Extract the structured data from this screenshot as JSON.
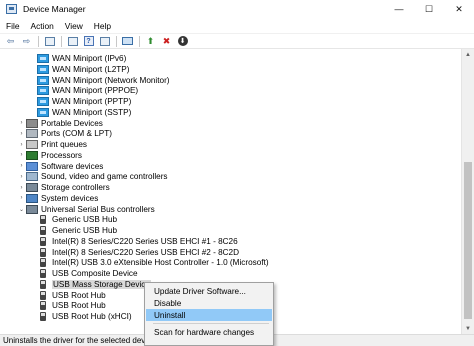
{
  "window": {
    "title": "Device Manager",
    "minimize": "—",
    "maximize": "☐",
    "close": "✕"
  },
  "menu": [
    "File",
    "Action",
    "View",
    "Help"
  ],
  "toolbar": {
    "back": "⇦",
    "forward": "⇨",
    "enable": "⬆",
    "disable": "✖",
    "uninstall": "⬇"
  },
  "tree": [
    {
      "label": "WAN Miniport (IPv6)",
      "level": 2,
      "icon": "network-adapter-icon"
    },
    {
      "label": "WAN Miniport (L2TP)",
      "level": 2,
      "icon": "network-adapter-icon"
    },
    {
      "label": "WAN Miniport (Network Monitor)",
      "level": 2,
      "icon": "network-adapter-icon"
    },
    {
      "label": "WAN Miniport (PPPOE)",
      "level": 2,
      "icon": "network-adapter-icon"
    },
    {
      "label": "WAN Miniport (PPTP)",
      "level": 2,
      "icon": "network-adapter-icon"
    },
    {
      "label": "WAN Miniport (SSTP)",
      "level": 2,
      "icon": "network-adapter-icon"
    },
    {
      "label": "Portable Devices",
      "level": 1,
      "icon": "portable-device-icon",
      "expander": "›"
    },
    {
      "label": "Ports (COM & LPT)",
      "level": 1,
      "icon": "port-icon",
      "expander": "›"
    },
    {
      "label": "Print queues",
      "level": 1,
      "icon": "printer-icon",
      "expander": "›"
    },
    {
      "label": "Processors",
      "level": 1,
      "icon": "processor-icon",
      "expander": "›"
    },
    {
      "label": "Software devices",
      "level": 1,
      "icon": "software-device-icon",
      "expander": "›"
    },
    {
      "label": "Sound, video and game controllers",
      "level": 1,
      "icon": "sound-icon",
      "expander": "›"
    },
    {
      "label": "Storage controllers",
      "level": 1,
      "icon": "storage-controller-icon",
      "expander": "›"
    },
    {
      "label": "System devices",
      "level": 1,
      "icon": "system-device-icon",
      "expander": "›"
    },
    {
      "label": "Universal Serial Bus controllers",
      "level": 1,
      "icon": "usb-controller-icon",
      "expander": "⌄"
    },
    {
      "label": "Generic USB Hub",
      "level": 2,
      "icon": "usb-icon"
    },
    {
      "label": "Generic USB Hub",
      "level": 2,
      "icon": "usb-icon"
    },
    {
      "label": "Intel(R) 8 Series/C220 Series USB EHCI #1 - 8C26",
      "level": 2,
      "icon": "usb-icon"
    },
    {
      "label": "Intel(R) 8 Series/C220 Series USB EHCI #2 - 8C2D",
      "level": 2,
      "icon": "usb-icon"
    },
    {
      "label": "Intel(R) USB 3.0 eXtensible Host Controller - 1.0 (Microsoft)",
      "level": 2,
      "icon": "usb-icon"
    },
    {
      "label": "USB Composite Device",
      "level": 2,
      "icon": "usb-icon"
    },
    {
      "label": "USB Mass Storage Device",
      "level": 2,
      "icon": "usb-icon",
      "selected": true
    },
    {
      "label": "USB Root Hub",
      "level": 2,
      "icon": "usb-icon"
    },
    {
      "label": "USB Root Hub",
      "level": 2,
      "icon": "usb-icon"
    },
    {
      "label": "USB Root Hub (xHCI)",
      "level": 2,
      "icon": "usb-icon"
    }
  ],
  "context_menu": {
    "items": [
      {
        "label": "Update Driver Software..."
      },
      {
        "label": "Disable"
      },
      {
        "label": "Uninstall",
        "active": true
      },
      {
        "separator": true
      },
      {
        "label": "Scan for hardware changes"
      }
    ]
  },
  "status": "Uninstalls the driver for the selected devi",
  "colors": {
    "selection": "#d9d9d9",
    "menu_highlight": "#91c9f7",
    "disable_red": "#cc1f1f",
    "enable_green": "#2e8b2e"
  }
}
